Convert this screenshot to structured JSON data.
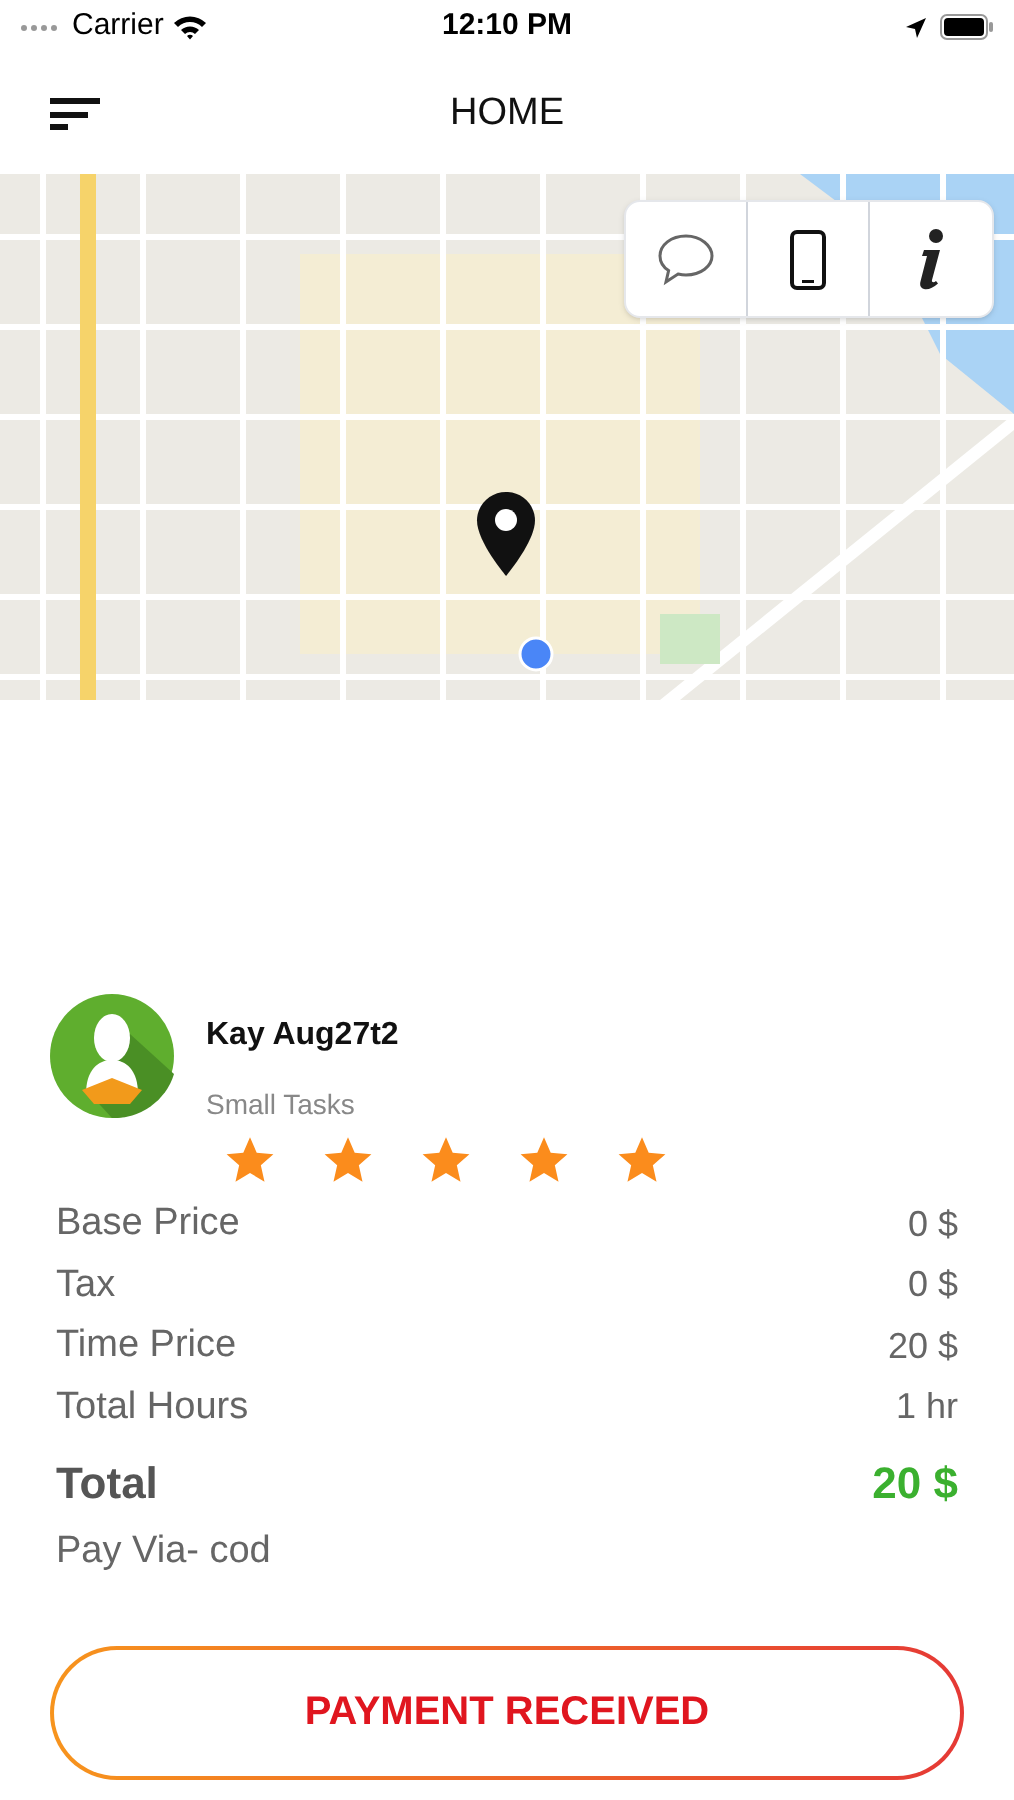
{
  "status_bar": {
    "carrier": "Carrier",
    "time": "12:10 PM"
  },
  "header": {
    "title": "HOME"
  },
  "provider": {
    "name": "Kay Aug27t2",
    "category": "Small Tasks",
    "stars": 5
  },
  "prices": [
    {
      "kind": "line",
      "label": "Base Price",
      "value": "0 $"
    },
    {
      "kind": "line",
      "label": "Tax",
      "value": "0 $"
    },
    {
      "kind": "line",
      "label": "Time Price",
      "value": "20 $"
    },
    {
      "kind": "line",
      "label": "Total Hours",
      "value": "1 hr"
    },
    {
      "kind": "total",
      "label": "Total",
      "value": "20 $"
    }
  ],
  "payment_method": "Pay Via- cod",
  "action_button": "PAYMENT RECEIVED"
}
